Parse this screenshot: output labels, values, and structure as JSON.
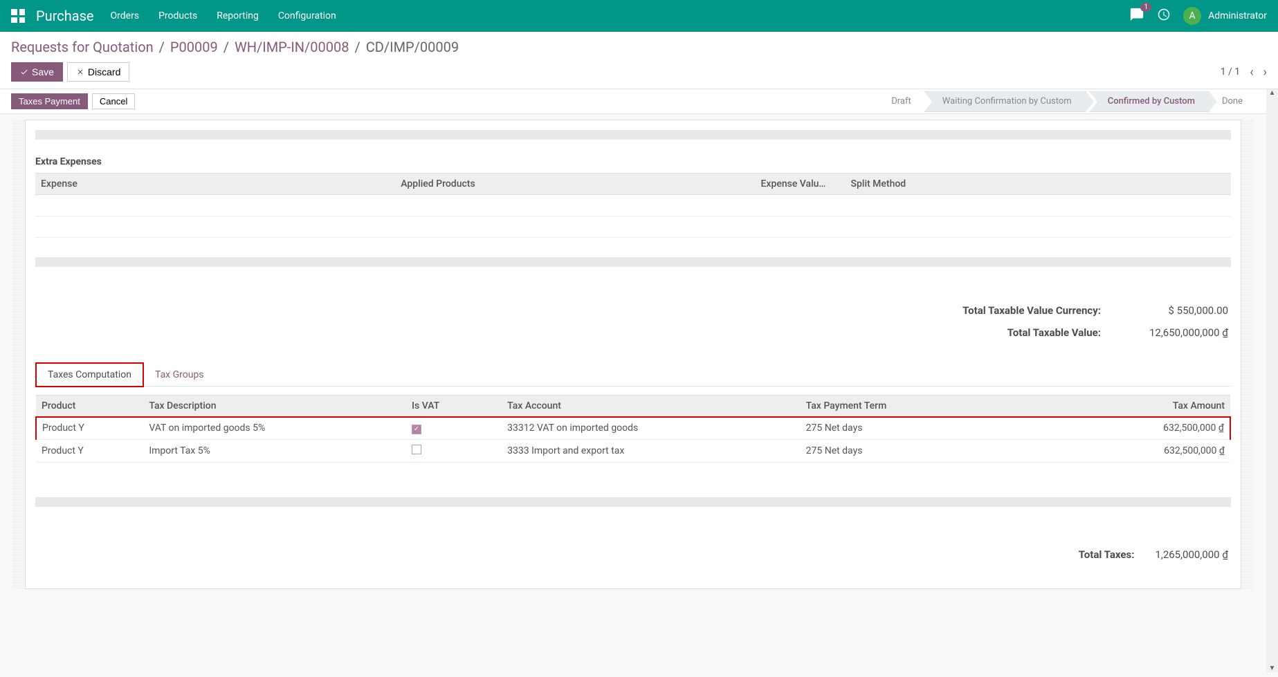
{
  "navbar": {
    "brand": "Purchase",
    "menu": [
      "Orders",
      "Products",
      "Reporting",
      "Configuration"
    ],
    "notify_count": "1",
    "avatar_letter": "A",
    "user_name": "Administrator"
  },
  "breadcrumb": {
    "items": [
      "Requests for Quotation",
      "P00009",
      "WH/IMP-IN/00008"
    ],
    "current": "CD/IMP/00009"
  },
  "buttons": {
    "save": "Save",
    "discard": "Discard"
  },
  "pager": {
    "value": "1 / 1"
  },
  "status_buttons": {
    "taxes_payment": "Taxes Payment",
    "cancel": "Cancel"
  },
  "status_steps": {
    "draft": "Draft",
    "waiting": "Waiting Confirmation by Custom",
    "confirmed": "Confirmed by Custom",
    "done": "Done"
  },
  "extra_expenses": {
    "title": "Extra Expenses",
    "headers": [
      "Expense",
      "Applied Products",
      "Expense Valu…",
      "Split Method"
    ]
  },
  "totals": {
    "currency_label": "Total Taxable Value Currency:",
    "currency_value": "$ 550,000.00",
    "value_label": "Total Taxable Value:",
    "value_value": "12,650,000,000 ₫"
  },
  "tabs": {
    "computation": "Taxes Computation",
    "groups": "Tax Groups"
  },
  "tax_table": {
    "headers": [
      "Product",
      "Tax Description",
      "Is VAT",
      "Tax Account",
      "Tax Payment Term",
      "Tax Amount"
    ],
    "rows": [
      {
        "product": "Product Y",
        "desc": "VAT on imported goods 5%",
        "is_vat": true,
        "account": "33312 VAT on imported goods",
        "term": "275 Net days",
        "amount": "632,500,000 ₫"
      },
      {
        "product": "Product Y",
        "desc": "Import Tax 5%",
        "is_vat": false,
        "account": "3333 Import and export tax",
        "term": "275 Net days",
        "amount": "632,500,000 ₫"
      }
    ]
  },
  "total_taxes": {
    "label": "Total Taxes:",
    "value": "1,265,000,000 ₫"
  }
}
